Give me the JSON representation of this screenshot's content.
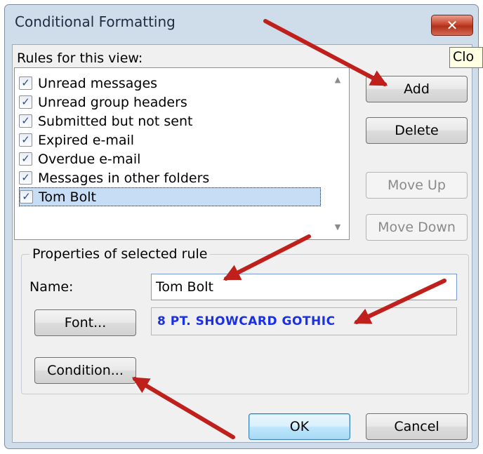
{
  "dialog": {
    "title": "Conditional Formatting",
    "close_tooltip": "Clo",
    "rules_label": "Rules for this view:",
    "rules": [
      {
        "label": "Unread messages",
        "checked": true
      },
      {
        "label": "Unread group headers",
        "checked": true
      },
      {
        "label": "Submitted but not sent",
        "checked": true
      },
      {
        "label": "Expired e-mail",
        "checked": true
      },
      {
        "label": "Overdue e-mail",
        "checked": true
      },
      {
        "label": "Messages in other folders",
        "checked": true
      },
      {
        "label": "Tom Bolt",
        "checked": true,
        "selected": true
      }
    ],
    "buttons": {
      "add": "Add",
      "delete": "Delete",
      "move_up": "Move Up",
      "move_down": "Move Down",
      "font": "Font...",
      "condition": "Condition...",
      "ok": "OK",
      "cancel": "Cancel"
    },
    "properties": {
      "legend": "Properties of selected rule",
      "name_label": "Name:",
      "name_value": "Tom Bolt",
      "font_preview": "8 PT. SHOWCARD GOTHIC"
    }
  },
  "colors": {
    "title_bar": "#cfdcea",
    "close_button": "#c9452d",
    "selection": "#c6ddf5",
    "font_preview_text": "#1a2fe8",
    "annotation_arrow": "#c0201c"
  },
  "icons": {
    "close": "close-x-icon",
    "check": "checkmark-icon",
    "scroll_up": "scroll-up-arrow-icon",
    "scroll_down": "scroll-down-arrow-icon",
    "annotation": "red-arrow-icon"
  }
}
